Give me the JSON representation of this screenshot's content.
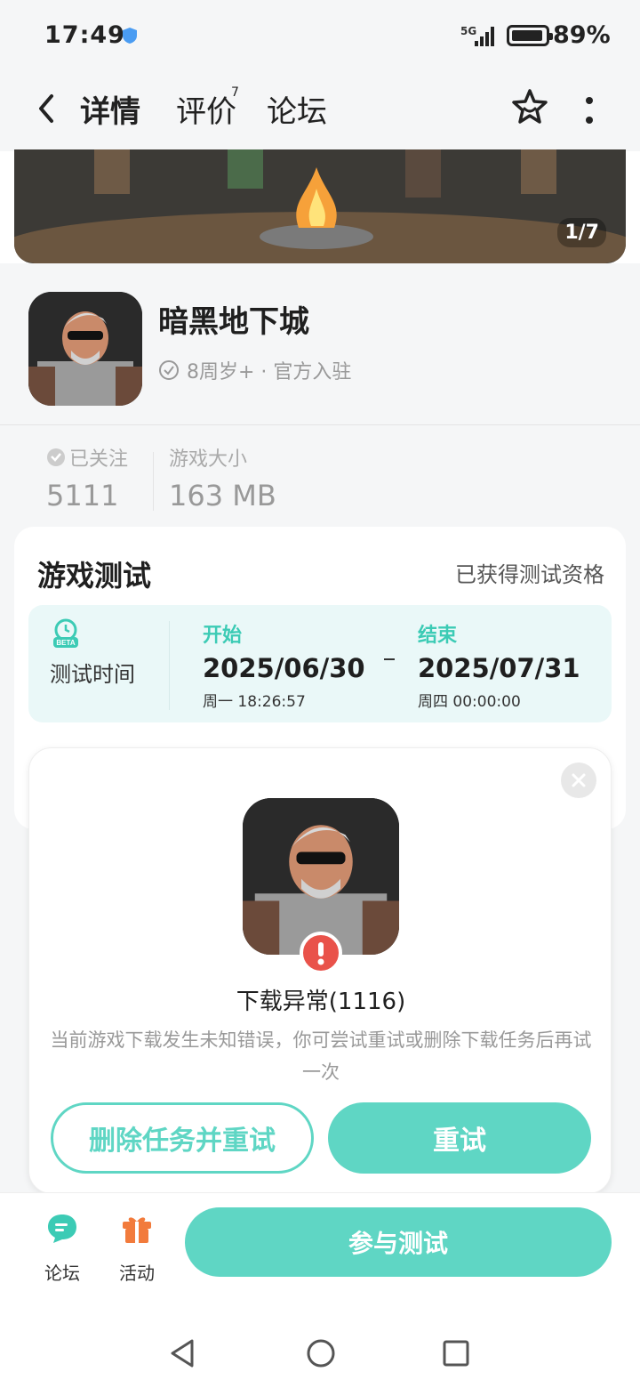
{
  "status": {
    "time": "17:49",
    "network": "5G",
    "battery": "89%"
  },
  "nav": {
    "tabs": {
      "detail": "详情",
      "review": "评价",
      "review_count": "7",
      "forum": "论坛"
    }
  },
  "banner": {
    "counter": "1/7"
  },
  "app": {
    "name": "暗黑地下城",
    "meta": "8周岁+ · 官方入驻"
  },
  "stats": {
    "followed_label": "已关注",
    "followed_value": "5111",
    "size_label": "游戏大小",
    "size_value": "163 MB"
  },
  "test": {
    "title": "游戏测试",
    "qualification": "已获得测试资格",
    "time_label": "测试时间",
    "start_head": "开始",
    "start_date": "2025/06/30",
    "start_sub": "周一  18:26:57",
    "end_head": "结束",
    "end_date": "2025/07/31",
    "end_sub": "周四  00:00:00"
  },
  "dialog": {
    "title": "下载异常(1116)",
    "message": "当前游戏下载发生未知错误，你可尝试重试或删除下载任务后再试一次",
    "delete_button": "删除任务并重试",
    "retry_button": "重试"
  },
  "bottombar": {
    "forum": "论坛",
    "activity": "活动",
    "join": "参与测试"
  },
  "colors": {
    "accent": "#5fd6c4",
    "error": "#e9524a",
    "background": "#f5f6f7"
  },
  "icons": [
    "back-icon",
    "star-icon",
    "more-icon",
    "check-icon",
    "heart-icon",
    "beta-icon",
    "close-icon",
    "error-icon",
    "forum-icon",
    "gift-icon",
    "nav-back-icon",
    "nav-home-icon",
    "nav-recent-icon"
  ]
}
